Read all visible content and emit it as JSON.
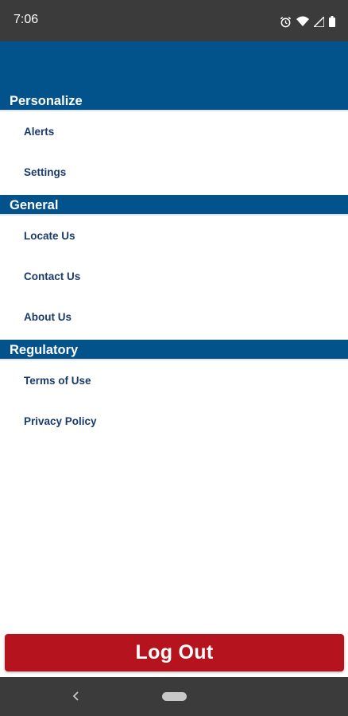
{
  "status_bar": {
    "time": "7:06",
    "icons": [
      "alarm-icon",
      "wifi-icon",
      "signal-icon",
      "battery-icon"
    ]
  },
  "sections": [
    {
      "title": "Personalize",
      "items": [
        {
          "label": "Alerts"
        },
        {
          "label": "Settings"
        }
      ]
    },
    {
      "title": "General",
      "items": [
        {
          "label": "Locate Us"
        },
        {
          "label": "Contact Us"
        },
        {
          "label": "About Us"
        }
      ]
    },
    {
      "title": "Regulatory",
      "items": [
        {
          "label": "Terms of Use"
        },
        {
          "label": "Privacy Policy"
        }
      ]
    }
  ],
  "logout": {
    "label": "Log Out"
  },
  "colors": {
    "header_blue": "#02528b",
    "item_text": "#1b3a6b",
    "logout_red": "#b5141e",
    "system_bar": "#3b3b3b"
  },
  "nav_bar": {
    "icons": [
      "back-icon",
      "home-pill-icon"
    ]
  }
}
